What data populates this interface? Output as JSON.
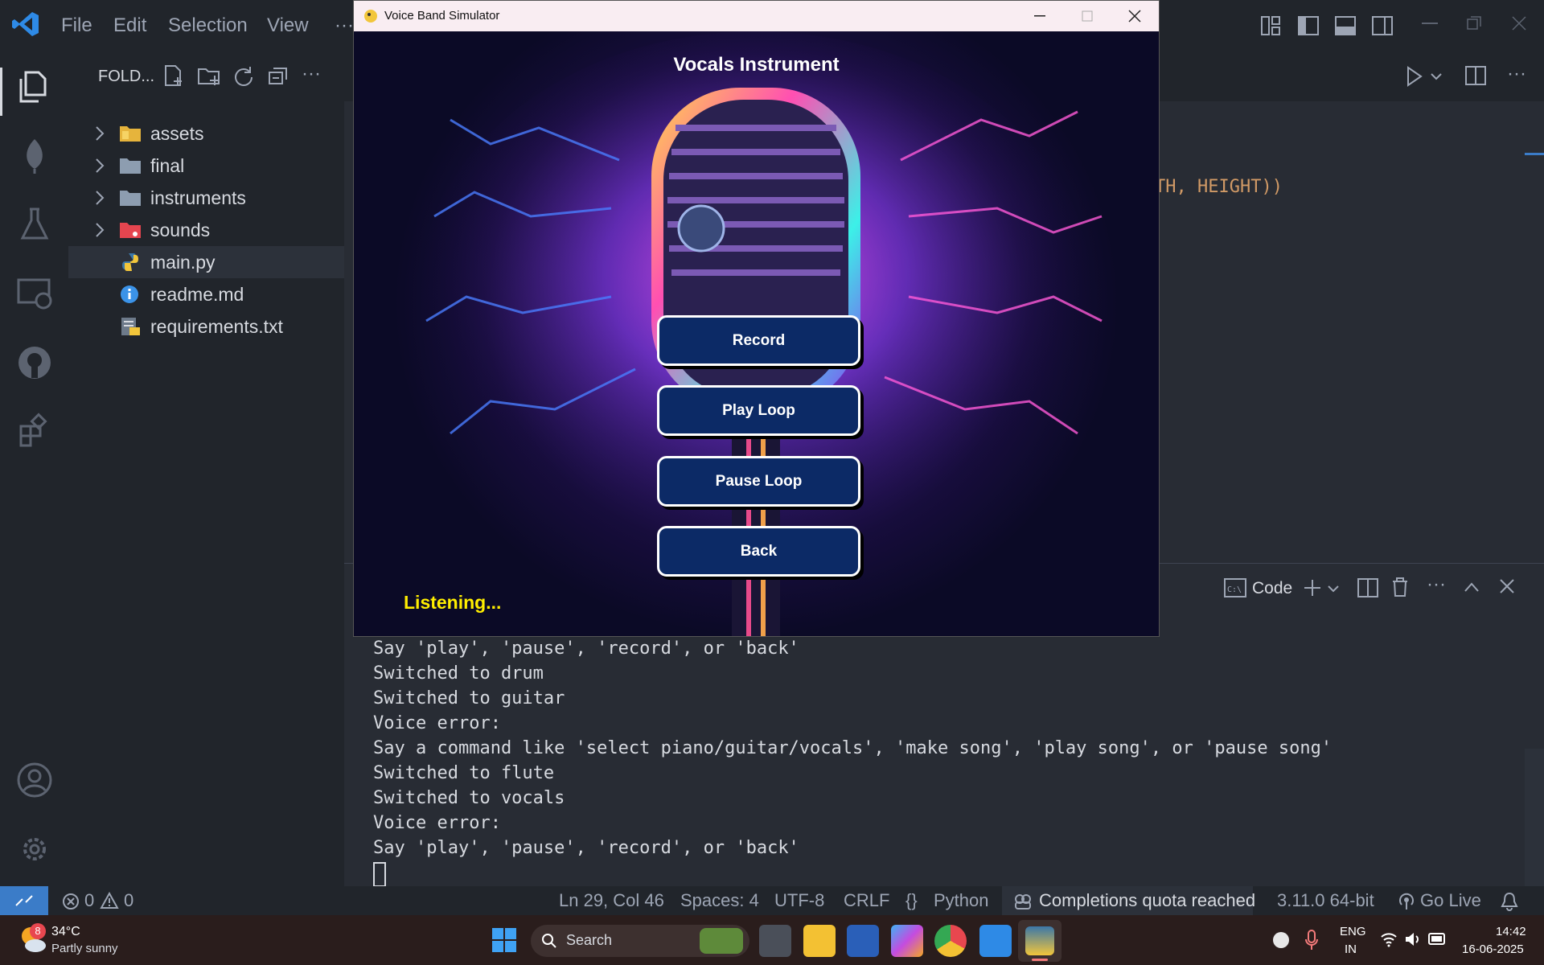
{
  "menu": {
    "file": "File",
    "edit": "Edit",
    "selection": "Selection",
    "view": "View",
    "more": "···"
  },
  "explorer": {
    "header": "FOLD...",
    "items": [
      {
        "label": "assets",
        "type": "folder"
      },
      {
        "label": "final",
        "type": "folder"
      },
      {
        "label": "instruments",
        "type": "folder"
      },
      {
        "label": "sounds",
        "type": "folder"
      },
      {
        "label": "main.py",
        "type": "file"
      },
      {
        "label": "readme.md",
        "type": "file"
      },
      {
        "label": "requirements.txt",
        "type": "file"
      }
    ]
  },
  "editor": {
    "code_fragment": "TH, HEIGHT))"
  },
  "panel": {
    "terminal_name": "Code",
    "lines": [
      "Say 'play', 'pause', 'record', or 'back'",
      "Switched to drum",
      "Switched to guitar",
      "Voice error:",
      "Say a command like 'select piano/guitar/vocals', 'make song', 'play song', or 'pause song'",
      "Switched to flute",
      "Switched to vocals",
      "Voice error:",
      "Say 'play', 'pause', 'record', or 'back'"
    ]
  },
  "game": {
    "window_title": "Voice Band Simulator",
    "heading": "Vocals Instrument",
    "buttons": {
      "record": "Record",
      "play_loop": "Play Loop",
      "pause_loop": "Pause Loop",
      "back": "Back"
    },
    "status": "Listening..."
  },
  "statusbar": {
    "errors": "0",
    "warnings": "0",
    "position": "Ln 29, Col 46",
    "spaces": "Spaces: 4",
    "encoding": "UTF-8",
    "eol": "CRLF",
    "language_icon": "{}",
    "language": "Python",
    "copilot": "Completions quota reached",
    "interpreter": "3.11.0 64-bit",
    "golive": "Go Live"
  },
  "taskbar": {
    "weather_badge": "8",
    "temperature": "34°C",
    "weather": "Partly sunny",
    "search": "Search",
    "lang_top": "ENG",
    "lang_bottom": "IN",
    "time": "14:42",
    "date": "16-06-2025"
  },
  "colors": {
    "accent": "#2e7bd6",
    "status_remote": "#3b7cc8",
    "listening": "#ffee00"
  }
}
